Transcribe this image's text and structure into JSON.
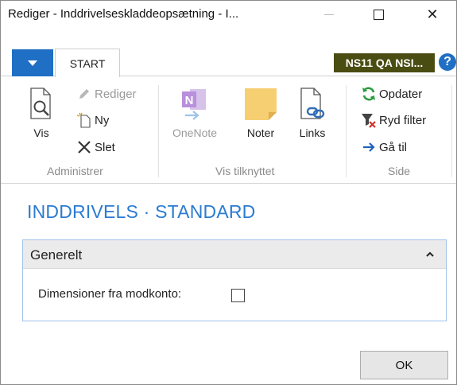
{
  "window": {
    "title": "Rediger - Inddrivelseskladdeopsætning - I...",
    "minimize_icon": "minimize-icon",
    "maximize_icon": "maximize-icon",
    "close_icon": "close-icon",
    "close_glyph": "✕"
  },
  "ribbon_tabs": {
    "app_menu_icon": "dropdown-triangle-icon",
    "start_label": "START",
    "company_label": "NS11 QA NSI...",
    "help_glyph": "?"
  },
  "ribbon": {
    "groups": {
      "manage": {
        "label": "Administrer",
        "view_label": "Vis",
        "edit_label": "Rediger",
        "new_label": "Ny",
        "delete_label": "Slet"
      },
      "attached": {
        "label": "Vis tilknyttet",
        "onenote_label": "OneNote",
        "notes_label": "Noter",
        "links_label": "Links"
      },
      "page": {
        "label": "Side",
        "refresh_label": "Opdater",
        "clear_filter_label": "Ryd filter",
        "goto_label": "Gå til"
      }
    }
  },
  "content": {
    "page_title": "INDDRIVELS · STANDARD",
    "fasttab": {
      "title": "Generelt",
      "fields": {
        "dimensions_label": "Dimensioner fra modkonto:",
        "dimensions_checked": false
      }
    }
  },
  "footer": {
    "ok_label": "OK"
  },
  "colors": {
    "accent": "#1f6fc4",
    "title_blue": "#2b7bd0",
    "company_bg": "#4a4d12",
    "fasttab_border": "#9fc2ea"
  }
}
